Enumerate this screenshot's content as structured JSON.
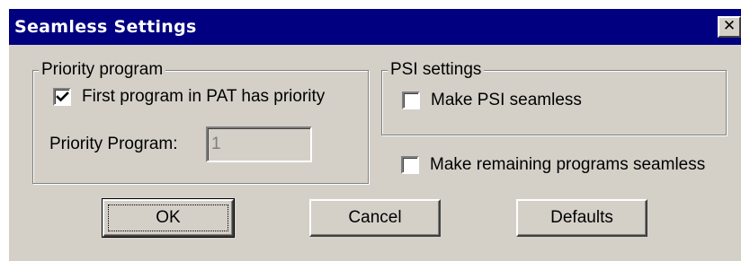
{
  "dialog": {
    "title": "Seamless Settings",
    "close_glyph": "✕",
    "close_icon": "close-icon"
  },
  "priority_group": {
    "legend": "Priority program",
    "first_program_checkbox": {
      "label": "First program in PAT has priority",
      "checked": true
    },
    "priority_program_label": "Priority Program:",
    "priority_program_value": "1",
    "priority_program_disabled": true
  },
  "psi_group": {
    "legend": "PSI settings",
    "make_psi_seamless_checkbox": {
      "label": "Make PSI seamless",
      "checked": false
    }
  },
  "remaining_checkbox": {
    "label": "Make remaining programs seamless",
    "checked": false
  },
  "buttons": {
    "ok": "OK",
    "cancel": "Cancel",
    "defaults": "Defaults"
  },
  "colors": {
    "titlebar": "#000080",
    "face": "#d4d0c8",
    "disabled_text": "#808080"
  }
}
